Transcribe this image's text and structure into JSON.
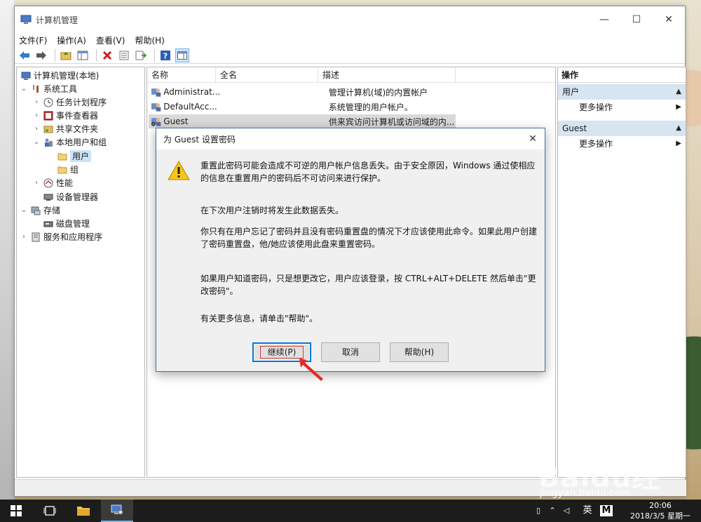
{
  "window": {
    "title": "计算机管理",
    "controls": {
      "minimize": "—",
      "maximize": "☐",
      "close": "✕"
    }
  },
  "menubar": [
    "文件(F)",
    "操作(A)",
    "查看(V)",
    "帮助(H)"
  ],
  "tree": {
    "root": "计算机管理(本地)",
    "system_tools": "系统工具",
    "task_scheduler": "任务计划程序",
    "event_viewer": "事件查看器",
    "shared_folders": "共享文件夹",
    "local_users_groups": "本地用户和组",
    "users": "用户",
    "groups": "组",
    "performance": "性能",
    "device_manager": "设备管理器",
    "storage": "存储",
    "disk_management": "磁盘管理",
    "services_apps": "服务和应用程序"
  },
  "list": {
    "columns": {
      "name": "名称",
      "fullname": "全名",
      "description": "描述"
    },
    "rows": [
      {
        "name": "Administrat...",
        "fullname": "",
        "description": "管理计算机(域)的内置帐户"
      },
      {
        "name": "DefaultAcc...",
        "fullname": "",
        "description": "系统管理的用户帐户。"
      },
      {
        "name": "Guest",
        "fullname": "",
        "description": "供来宾访问计算机或访问域的内..."
      }
    ]
  },
  "actions": {
    "header": "操作",
    "group1": "用户",
    "more1": "更多操作",
    "group2": "Guest",
    "more2": "更多操作"
  },
  "dialog": {
    "title": "为 Guest 设置密码",
    "p1": "重置此密码可能会造成不可逆的用户帐户信息丢失。由于安全原因，Windows 通过使相应的信息在重置用户的密码后不可访问来进行保护。",
    "p2": "在下次用户注销时将发生此数据丢失。",
    "p3": "你只有在用户忘记了密码并且没有密码重置盘的情况下才应该使用此命令。如果此用户创建了密码重置盘，他/她应该使用此盘来重置密码。",
    "p4": "如果用户知道密码，只是想更改它，用户应该登录，按 CTRL+ALT+DELETE 然后单击\"更改密码\"。",
    "p5": "有关更多信息，请单击\"帮助\"。",
    "btn_continue": "继续(P)",
    "btn_cancel": "取消",
    "btn_help": "帮助(H)"
  },
  "taskbar": {
    "ime": "英",
    "ime2": "M",
    "time": "20:06",
    "date": "2018/3/5 星期一"
  },
  "watermark": {
    "brand": "Baidu经验",
    "url": "jingyan.baidu.com"
  },
  "colors": {
    "accent": "#0078d7",
    "selection": "#cce4f7",
    "action_group": "#d7e4f2",
    "callout": "#e02b2b"
  }
}
